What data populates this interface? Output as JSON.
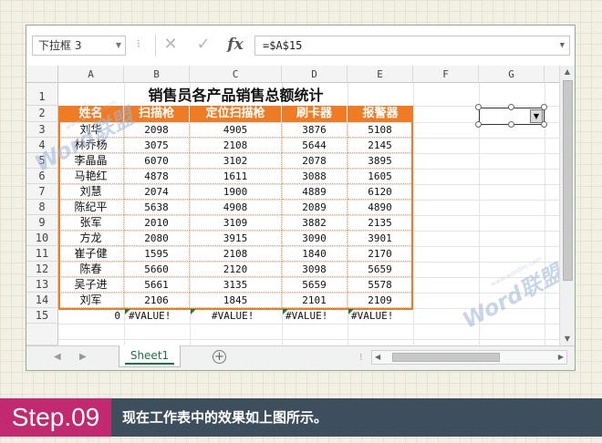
{
  "formula_bar": {
    "name_box": "下拉框 3",
    "name_box_dropdown_icon": "chevron-down-icon",
    "cancel_symbol": "✕",
    "enter_symbol": "✓",
    "fx_label": "fx",
    "formula": "=$A$15",
    "formula_dropdown_icon": "chevron-down-icon"
  },
  "column_headers": [
    "A",
    "B",
    "C",
    "D",
    "E",
    "F",
    "G"
  ],
  "row_headers": [
    "1",
    "2",
    "3",
    "4",
    "5",
    "6",
    "7",
    "8",
    "9",
    "10",
    "11",
    "12",
    "13",
    "14",
    "15"
  ],
  "sheet": {
    "title": "销售员各产品销售总额统计",
    "header_row": [
      "姓名",
      "扫描枪",
      "定位扫描枪",
      "刷卡器",
      "报警器"
    ],
    "rows": [
      [
        "刘华",
        "2098",
        "4905",
        "3876",
        "5108"
      ],
      [
        "林乔杨",
        "3075",
        "2108",
        "5644",
        "2145"
      ],
      [
        "李晶晶",
        "6070",
        "3102",
        "2078",
        "3895"
      ],
      [
        "马艳红",
        "4878",
        "1611",
        "3088",
        "1605"
      ],
      [
        "刘慧",
        "2074",
        "1900",
        "4889",
        "6120"
      ],
      [
        "陈纪平",
        "5638",
        "4908",
        "2089",
        "4890"
      ],
      [
        "张军",
        "2010",
        "3109",
        "3882",
        "2135"
      ],
      [
        "方龙",
        "2080",
        "3915",
        "3090",
        "3901"
      ],
      [
        "崔子健",
        "1595",
        "2108",
        "1840",
        "2170"
      ],
      [
        "陈春",
        "5660",
        "2120",
        "3098",
        "5659"
      ],
      [
        "吴子进",
        "5661",
        "3135",
        "5659",
        "5578"
      ],
      [
        "刘军",
        "2106",
        "1845",
        "2101",
        "2109"
      ]
    ],
    "row15": [
      "0",
      "#VALUE!",
      "#VALUE!",
      "#VALUE!",
      "#VALUE!"
    ]
  },
  "sheet_tab": "Sheet1",
  "add_sheet_symbol": "+",
  "watermark": {
    "large": "Word联盟",
    "small": "www.wordlm.com"
  },
  "footer": {
    "step": "Step.09",
    "caption": "现在工作表中的效果如上图所示。"
  },
  "colors": {
    "header_fill": "#f07b25",
    "step_bg": "#c3296f",
    "caption_bg": "#3d4e5c",
    "tab_accent": "#1e7145"
  }
}
